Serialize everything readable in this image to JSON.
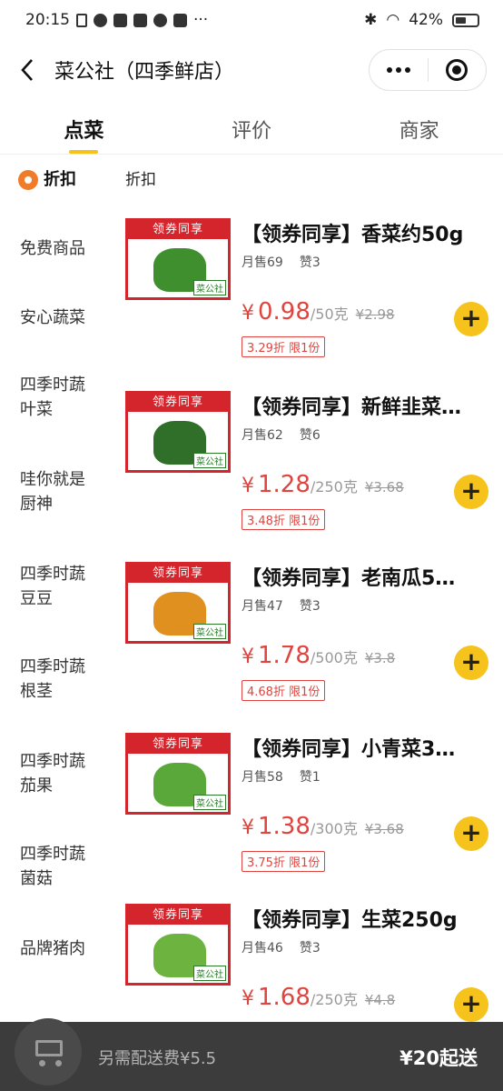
{
  "status_bar": {
    "time": "20:15",
    "battery": "42%"
  },
  "nav": {
    "title": "菜公社（四季鲜店）"
  },
  "tabs": [
    {
      "label": "点菜",
      "active": true
    },
    {
      "label": "评价",
      "active": false
    },
    {
      "label": "商家",
      "active": false
    }
  ],
  "sidebar": {
    "active": "折扣",
    "items": [
      "免费商品",
      "安心蔬菜",
      "四季时蔬",
      "叶菜",
      "哇你就是",
      "厨神",
      "四季时蔬",
      "豆豆",
      "四季时蔬",
      "根茎",
      "四季时蔬",
      "茄果",
      "四季时蔬",
      "菌菇",
      "品牌猪肉"
    ]
  },
  "section_title": "折扣",
  "ribbon_text": "领券同享",
  "brand_tag": "菜公社",
  "currency": "¥",
  "products": [
    {
      "name": "【领券同享】香菜约50g",
      "monthly_sales": "月售69",
      "likes": "赞3",
      "price": "0.98",
      "unit": "/50克",
      "orig_price": "¥2.98",
      "discount": "3.29折 限1份",
      "veg_color": "#3f8f2f"
    },
    {
      "name": "【领券同享】新鲜韭菜…",
      "monthly_sales": "月售62",
      "likes": "赞6",
      "price": "1.28",
      "unit": "/250克",
      "orig_price": "¥3.68",
      "discount": "3.48折 限1份",
      "veg_color": "#2f6f2a"
    },
    {
      "name": "【领券同享】老南瓜5…",
      "monthly_sales": "月售47",
      "likes": "赞3",
      "price": "1.78",
      "unit": "/500克",
      "orig_price": "¥3.8",
      "discount": "4.68折 限1份",
      "veg_color": "#e0901e"
    },
    {
      "name": "【领券同享】小青菜3…",
      "monthly_sales": "月售58",
      "likes": "赞1",
      "price": "1.38",
      "unit": "/300克",
      "orig_price": "¥3.68",
      "discount": "3.75折 限1份",
      "veg_color": "#5aa83a"
    },
    {
      "name": "【领券同享】生菜250g",
      "monthly_sales": "月售46",
      "likes": "赞3",
      "price": "1.68",
      "unit": "/250克",
      "orig_price": "¥4.8",
      "discount": "",
      "veg_color": "#6db33f"
    }
  ],
  "cart": {
    "delivery_note": "另需配送费¥5.5",
    "min_order": "¥20起送"
  }
}
